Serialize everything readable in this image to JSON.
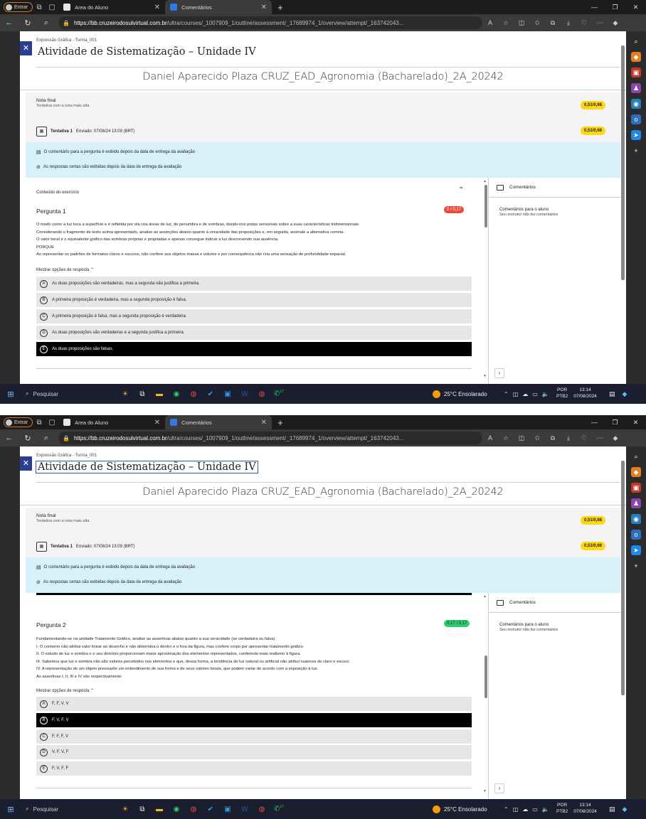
{
  "browser": {
    "profile_label": "Entrar",
    "tab1_title": "Area do Aluno",
    "tab2_title": "Comentários",
    "url_domain": "https://bb.cruzeirodosulvirtual.com.br",
    "url_path": "/ultra/courses/_1007909_1/outline/assessment/_17689974_1/overview/attempt/_163742043..."
  },
  "page": {
    "course": "Expressão Gráfica - Turma_001",
    "title": "Atividade de Sistematização – Unidade IV",
    "student": "Daniel Aparecido Plaza CRUZ_EAD_Agronomia (Bacharelado)_2A_20242",
    "nota_label": "Nota final",
    "nota_sub": "Tentativa com a nota mais alta",
    "nota_score": "0,51/0,68",
    "tentativa_label": "Tentativa 1",
    "tentativa_sent": "Enviado: 07/08/24 13:09 (BRT)",
    "tentativa_score": "0,51/0,68",
    "info1": "O comentário para a pergunta é exibido depois da data de entrega da avaliação",
    "info2": "As respostas certas são exibidas depois da data de entrega da avaliação",
    "content_label": "Conteúdo do exercício",
    "show_options": "Mostrar opções de resposta ⌃"
  },
  "comments": {
    "header": "Comentários",
    "title": "Comentários para o aluno",
    "sub": "Seu instrutor não fez comentários"
  },
  "q1": {
    "title": "Pergunta 1",
    "score": "0 / 0,17",
    "lines": [
      "O modo como a luz toca a superfície e é refletida por ela cria áreas de luz, de penumbra e de sombras, dando-nos pistas sensoriais sobre a suas características tridimensionais.",
      "Considerando o fragmento de texto acima apresentado, analise as asserções abaixo quanto à veracidade das proposições e, em seguida, assinale a alternativa correta.",
      "O valor tonal é o equivalente gráfico das sombras próprias e projetadas e apenas consegue indicar a luz descrevendo sua ausência.",
      "PORQUE",
      "Ao representar os padrões de formatos claros e escuros, não confere aos objetos massa e volume e por consequência não cria uma sensação de profundidade espacial."
    ],
    "options": [
      {
        "letter": "A",
        "text": "As duas proposições são verdadeiras, mas a segunda não justifica a primeira."
      },
      {
        "letter": "B",
        "text": "A primeira proposição é verdadeira, mas a segunda proposição é falsa."
      },
      {
        "letter": "C",
        "text": "A primeira proposição é falsa, mas a segunda proposição é verdadeira."
      },
      {
        "letter": "D",
        "text": "As duas proposições são verdadeiras e a segunda justifica a primeira."
      },
      {
        "letter": "E",
        "text": "As duas proposições são falsas."
      }
    ]
  },
  "q2": {
    "title": "Pergunta 2",
    "score": "0,17 / 0,17",
    "lines": [
      "Fundamentando-se na unidade Tratamento Gráfico, analise as assertivas abaixo quanto a sua veracidade (se verdadeira ou falsa).",
      "I. O contorno não atribui valor linear ao desenho e não determina o dentro e o fora da figura, mas confere corpo por apresentar tratamento gráfico.",
      "II. O estudo de luz e sombra e o seu domínio proporcionam maior aproximação dos elementos representados, conferindo mais realismo à figura.",
      "III. Sabemos que luz e sombra não são valores percebidos nos elementos e que, dessa forma, a incidência de luz natural ou artificial não atribui nuances de claro e escuro.",
      "IV. A representação de um objeto pressupõe um entendimento de sua forma e de seus valores tonais, que podem variar de acordo com a exposição à luz.",
      "As assertivas I, II, III e IV são respectivamente:"
    ],
    "options": [
      {
        "letter": "A",
        "text": "F, F, V, V"
      },
      {
        "letter": "B",
        "text": "F, V, F, V"
      },
      {
        "letter": "C",
        "text": "F, F, F, V"
      },
      {
        "letter": "D",
        "text": "V, F, V, F"
      },
      {
        "letter": "E",
        "text": "F, V, F, F"
      }
    ]
  },
  "taskbar": {
    "search": "Pesquisar",
    "weather": "25°C  Ensolarado",
    "lang1": "POR",
    "lang2": "PTB2",
    "time": "13:14",
    "date": "07/08/2024",
    "badge": "17"
  },
  "colors": {
    "accent": "#2c3e8f",
    "pill": "#ffd814",
    "info_bg": "#d7f0f9",
    "wrong": "#e74c3c",
    "right": "#2ecc71"
  }
}
